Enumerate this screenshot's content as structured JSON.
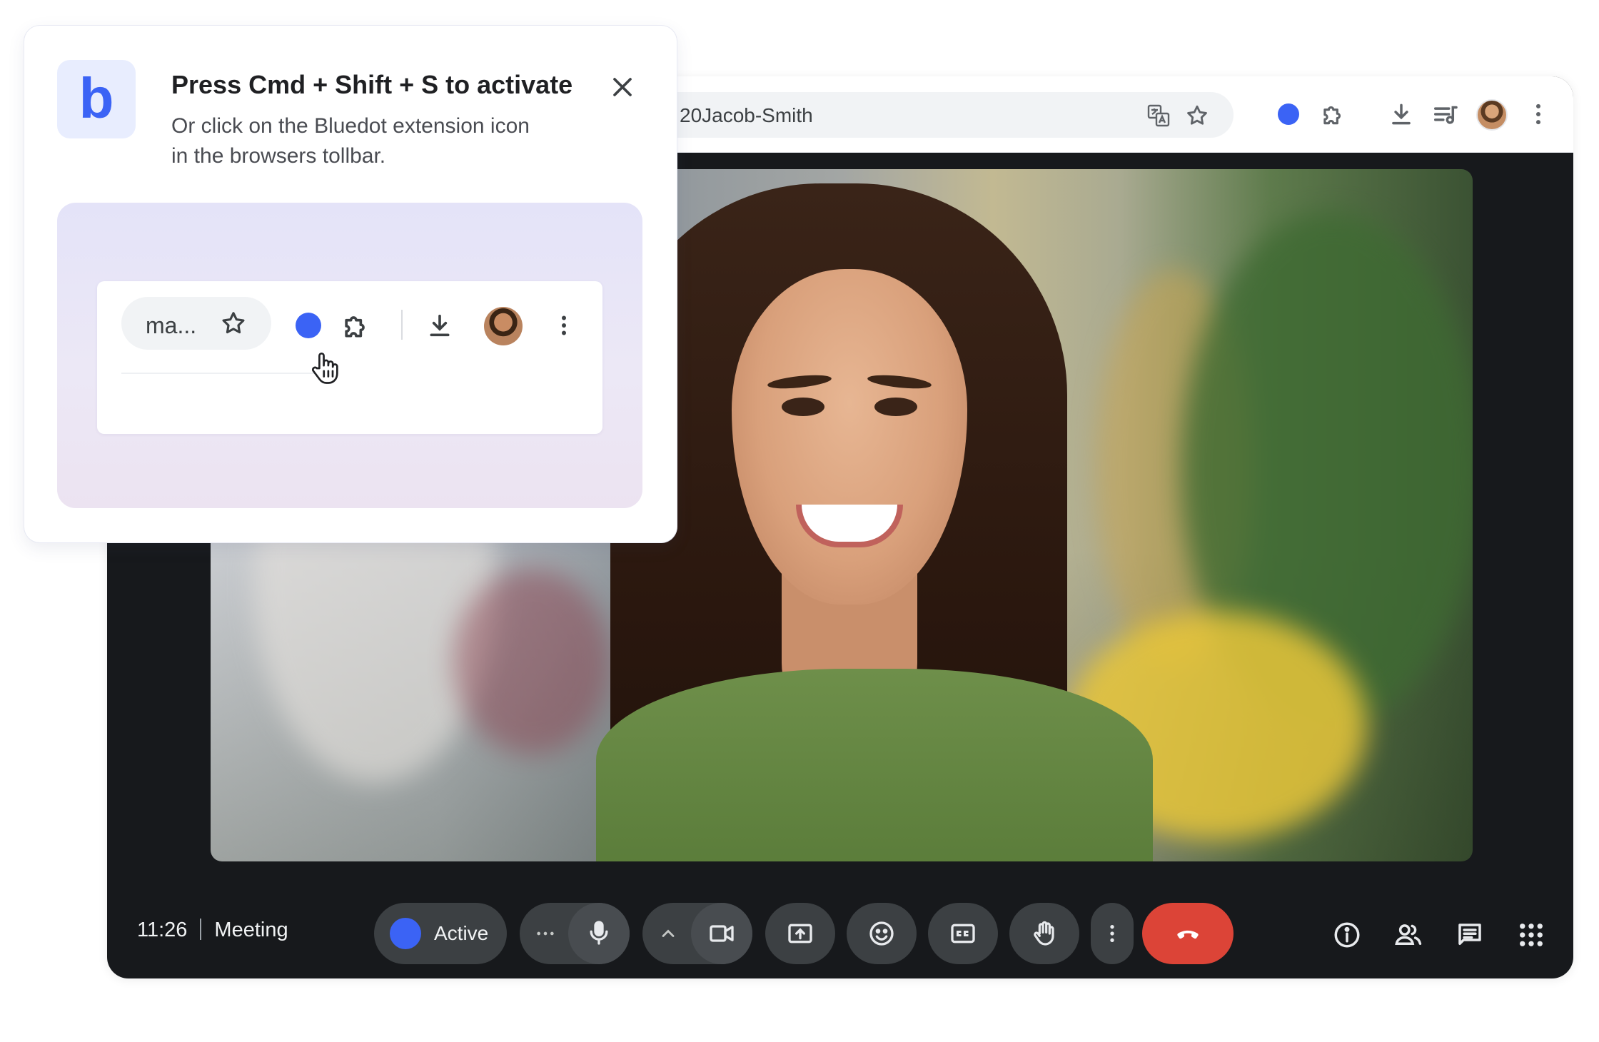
{
  "popup": {
    "title": "Press Cmd + Shift + S to activate",
    "subtitle_line1": "Or click on the Bluedot extension icon",
    "subtitle_line2": "in the browsers tollbar.",
    "logo_letter": "b",
    "icons": {
      "close": "close-icon"
    },
    "preview": {
      "omnibox_text": "ma...",
      "icons": [
        "star-icon",
        "bluedot-extension-icon",
        "puzzle-extension-icon",
        "download-icon",
        "avatar",
        "more-vert-icon",
        "hand-cursor-icon"
      ]
    }
  },
  "browser": {
    "omnibox_text": "20Jacob-Smith",
    "icons": [
      "translate-icon",
      "star-icon",
      "bluedot-extension-icon",
      "puzzle-extension-icon",
      "download-icon",
      "media-queue-icon",
      "avatar",
      "more-vert-icon"
    ]
  },
  "meeting": {
    "time": "11:26",
    "name": "Meeting",
    "bluedot_status": "Active",
    "controls": [
      "more-horiz-icon",
      "mic-icon",
      "chevron-up-icon",
      "camera-icon",
      "present-icon",
      "emoji-icon",
      "captions-icon",
      "raise-hand-icon",
      "more-vert-icon",
      "hang-up-icon"
    ],
    "right_icons": [
      "info-icon",
      "people-icon",
      "chat-icon",
      "apps-grid-icon"
    ]
  },
  "colors": {
    "accent_blue": "#3b63f5",
    "logo_tile": "#e8edfe",
    "meet_background": "#17191c",
    "control_background": "#3c4043",
    "hangup_red": "#dc4437"
  }
}
